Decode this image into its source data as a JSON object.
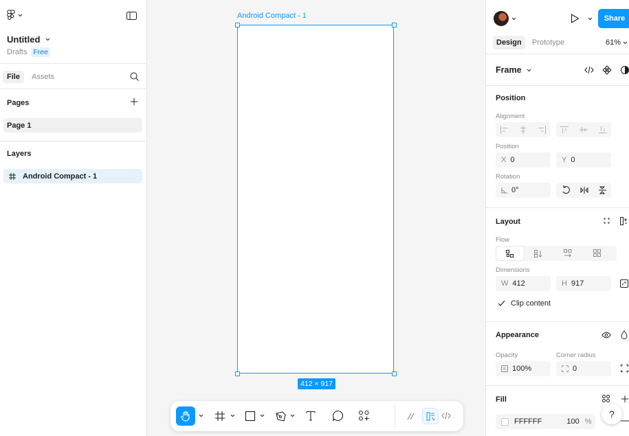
{
  "file": {
    "name": "Untitled",
    "location": "Drafts",
    "plan_badge": "Free"
  },
  "left_tabs": {
    "file": "File",
    "assets": "Assets"
  },
  "pages": {
    "title": "Pages",
    "items": [
      "Page 1"
    ]
  },
  "layers": {
    "title": "Layers",
    "items": [
      "Android Compact - 1"
    ]
  },
  "canvas": {
    "frame_label": "Android Compact - 1",
    "dimensions_badge": "412 × 917"
  },
  "right": {
    "share_label": "Share",
    "tabs": {
      "design": "Design",
      "prototype": "Prototype"
    },
    "zoom": "61%",
    "frame_title": "Frame",
    "position_section": {
      "title": "Position",
      "alignment_label": "Alignment",
      "position_label": "Position",
      "x_label": "X",
      "x_value": "0",
      "y_label": "Y",
      "y_value": "0",
      "rotation_label": "Rotation",
      "rotation_value": "0°"
    },
    "layout_section": {
      "title": "Layout",
      "flow_label": "Flow",
      "dimensions_label": "Dimensions",
      "w_label": "W",
      "w_value": "412",
      "h_label": "H",
      "h_value": "917",
      "clip_label": "Clip content",
      "clip_checked": true
    },
    "appearance_section": {
      "title": "Appearance",
      "opacity_label": "Opacity",
      "opacity_value": "100%",
      "radius_label": "Corner radius",
      "radius_value": "0"
    },
    "fill_section": {
      "title": "Fill",
      "hex": "FFFFFF",
      "opacity": "100",
      "unit": "%"
    },
    "help_label": "?"
  },
  "colors": {
    "accent": "#0d99ff",
    "selection_bg": "#e5f2fc"
  }
}
